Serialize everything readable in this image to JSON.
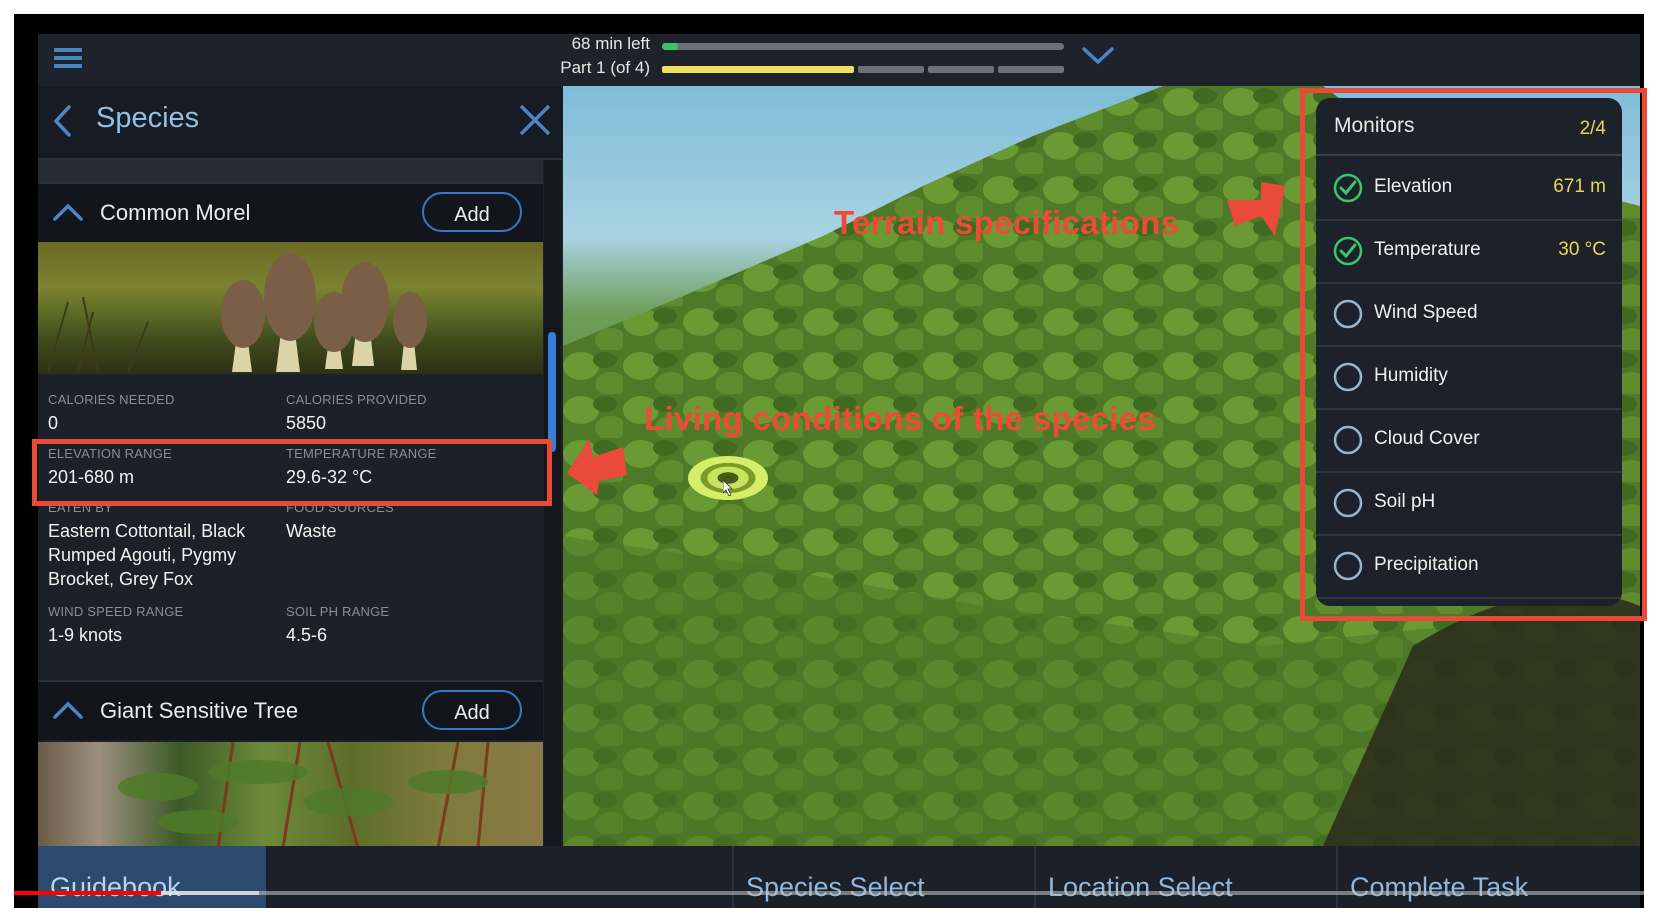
{
  "topbar": {
    "menu_icon": "hamburger-menu-icon",
    "time_left": "68 min left",
    "time_progress": 0.03,
    "part_label": "Part 1 (of 4)",
    "parts_total": 4,
    "parts_current": 1,
    "expand_icon": "chevron-down-icon"
  },
  "panel": {
    "title": "Species",
    "back_icon": "chevron-left-icon",
    "close_icon": "close-x-icon",
    "species": [
      {
        "name": "Common Morel",
        "add_label": "Add",
        "image": "morel-mushrooms-image",
        "stats": [
          {
            "label": "CALORIES NEEDED",
            "value": "0"
          },
          {
            "label": "CALORIES PROVIDED",
            "value": "5850"
          },
          {
            "label": "ELEVATION RANGE",
            "value": "201-680 m"
          },
          {
            "label": "TEMPERATURE RANGE",
            "value": "29.6-32 °C"
          },
          {
            "label": "EATEN BY",
            "value": "Eastern Cottontail, Black Rumped Agouti, Pygmy Brocket, Grey Fox"
          },
          {
            "label": "FOOD SOURCES",
            "value": "Waste"
          },
          {
            "label": "WIND SPEED RANGE",
            "value": "1-9 knots"
          },
          {
            "label": "SOIL PH RANGE",
            "value": "4.5-6"
          }
        ]
      },
      {
        "name": "Giant Sensitive Tree",
        "add_label": "Add",
        "image": "giant-sensitive-tree-image"
      }
    ]
  },
  "monitors": {
    "title": "Monitors",
    "count": "2/4",
    "items": [
      {
        "label": "Elevation",
        "value": "671 m",
        "checked": true
      },
      {
        "label": "Temperature",
        "value": "30 °C",
        "checked": true
      },
      {
        "label": "Wind Speed",
        "value": "",
        "checked": false
      },
      {
        "label": "Humidity",
        "value": "",
        "checked": false
      },
      {
        "label": "Cloud Cover",
        "value": "",
        "checked": false
      },
      {
        "label": "Soil pH",
        "value": "",
        "checked": false
      },
      {
        "label": "Precipitation",
        "value": "",
        "checked": false
      }
    ]
  },
  "tabs": [
    {
      "label": "Guidebook",
      "active": true
    },
    {
      "label": "Species Select",
      "active": false
    },
    {
      "label": "Location Select",
      "active": false
    },
    {
      "label": "Complete Task",
      "active": false
    }
  ],
  "annotations": {
    "terrain": "Terrain specifications",
    "living": "Living conditions of the species",
    "color": "#ea4a3a"
  },
  "video": {
    "played_fraction": 0.09,
    "buffered_fraction": 0.15
  },
  "colors": {
    "accent_blue": "#3a78c0",
    "value_yellow": "#e6d65a",
    "check_green": "#3cc46a",
    "progress_yellow": "#f0df5c"
  }
}
